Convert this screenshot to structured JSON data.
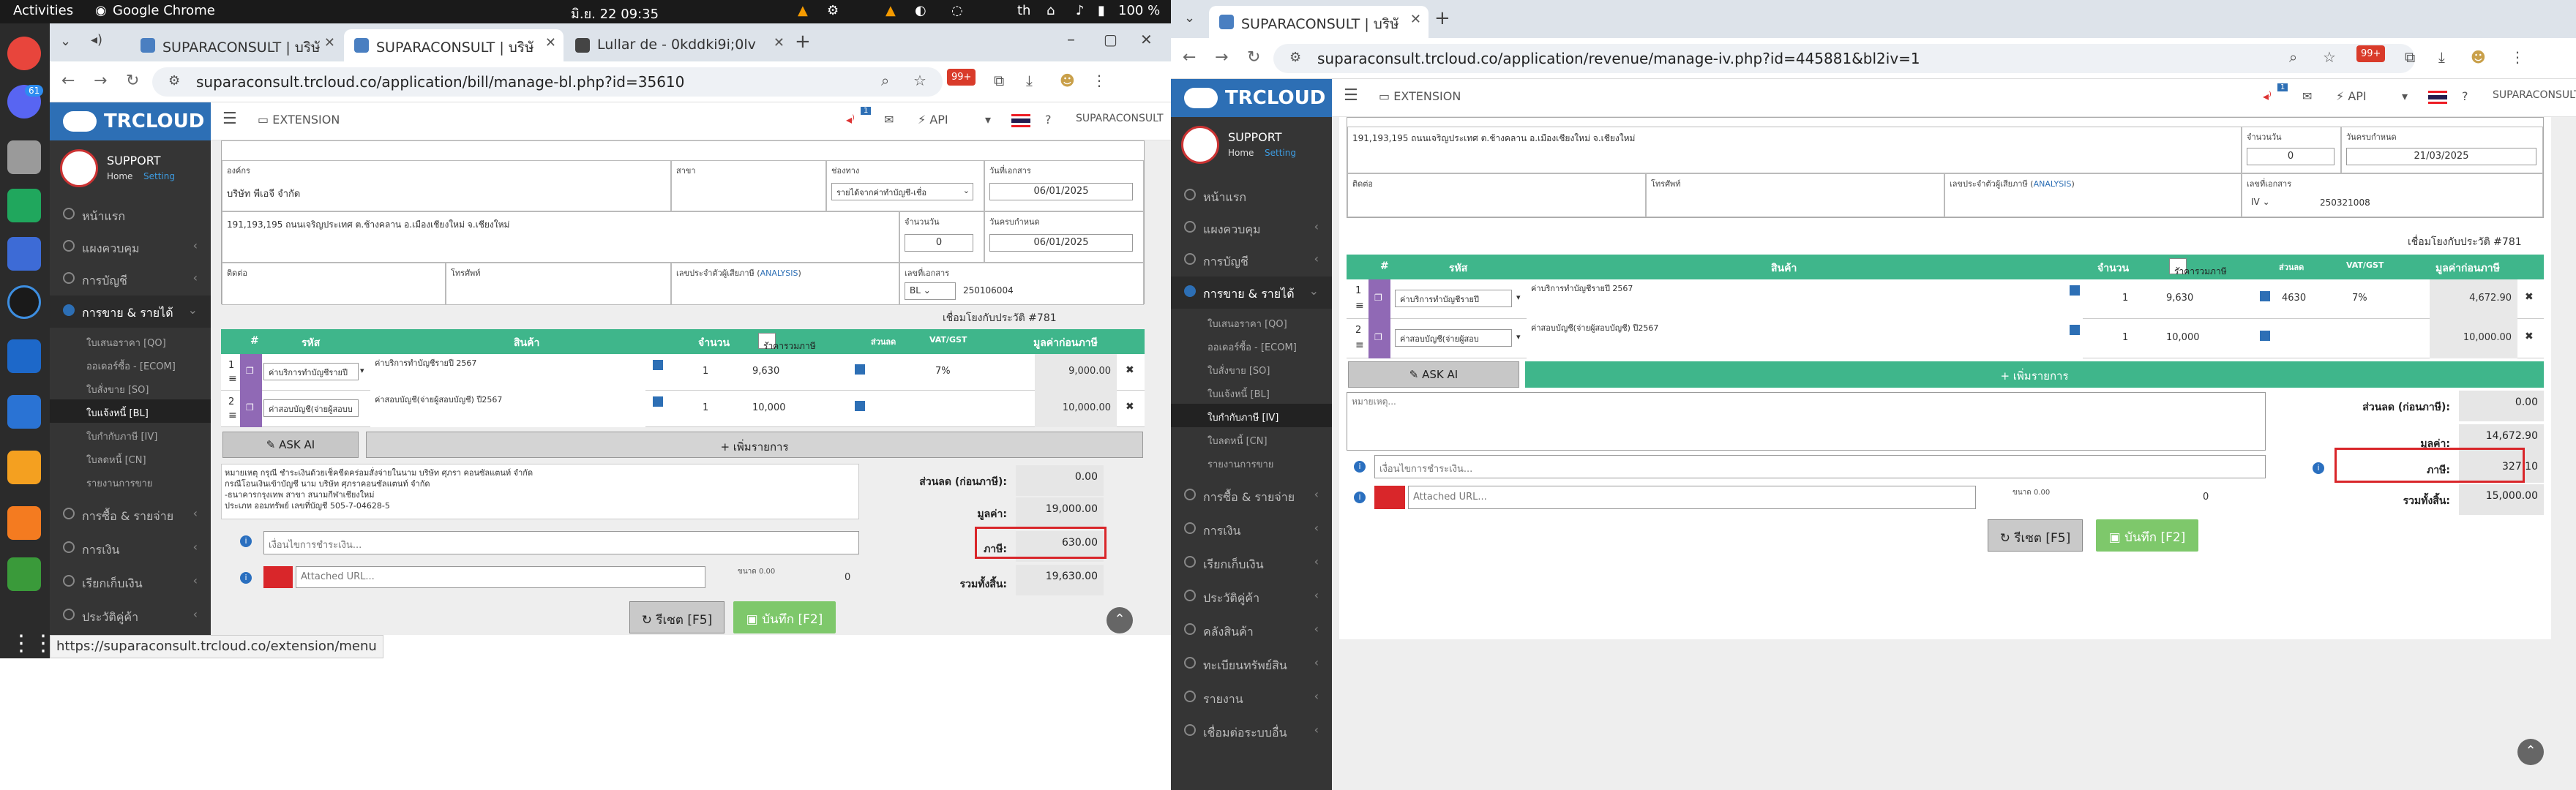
{
  "gnome": {
    "activities": "Activities",
    "app_name": "Google Chrome",
    "clock": "มิ.ย. 22  09:35",
    "lang": "th",
    "battery": "100 %"
  },
  "dock": {
    "discord_badge": "61"
  },
  "left_window": {
    "tabs": [
      {
        "label": "SUPARACONSULT | บริษั"
      },
      {
        "label": "SUPARACONSULT | บริษั"
      },
      {
        "label": "Lullar de - 0kddki9i;0lv"
      }
    ],
    "url": "suparaconsult.trcloud.co/application/bill/manage-bl.php?id=35610",
    "ext_badge": "99+",
    "brand": "TRCLOUD",
    "extension_label": "EXTENSION",
    "api_label": "API",
    "company_label": "SUPARACONSULT",
    "notif_count": "1",
    "user": {
      "name": "SUPPORT",
      "home": "Home",
      "setting": "Setting"
    },
    "menu": [
      {
        "label": "หน้าแรก"
      },
      {
        "label": "แผงควบคุม"
      },
      {
        "label": "การบัญชี"
      },
      {
        "label": "การขาย & รายได้"
      }
    ],
    "submenu": [
      {
        "label": "ใบเสนอราคา [QO]"
      },
      {
        "label": "ออเดอร์ซื้อ - [ECOM]"
      },
      {
        "label": "ใบสั่งขาย [SO]"
      },
      {
        "label": "ใบแจ้งหนี้ [BL]"
      },
      {
        "label": "ใบกำกับภาษี [IV]"
      },
      {
        "label": "ใบลดหนี้ [CN]"
      },
      {
        "label": "รายงานการขาย"
      }
    ],
    "menu_bottom": [
      {
        "label": "การซื้อ & รายจ่าย"
      },
      {
        "label": "การเงิน"
      },
      {
        "label": "เรียกเก็บเงิน"
      },
      {
        "label": "ประวัติคู่ค้า"
      }
    ],
    "form": {
      "customer_label": "องค์กร",
      "customer": "บริษัท พีเอจี จำกัด",
      "branch_label": "สาขา",
      "channel_label": "ช่องทาง",
      "channel": "รายได้จากค่าทำบัญชี-เชื่อ",
      "doc_date_label": "วันที่เอกสาร",
      "doc_date": "06/01/2025",
      "address": "191,193,195 ถนนเจริญประเทศ ต.ช้างคลาน อ.เมืองเชียงใหม่ จ.เชียงใหม่",
      "credit_label": "จำนวนวัน",
      "credit": "0",
      "due_label": "วันครบกำหนด",
      "due": "06/01/2025",
      "contact_label": "ติดต่อ",
      "phone_label": "โทรศัพท์",
      "tax_label": "เลขประจำตัวผู้เสียภาษี",
      "analysis": "ANALYSIS",
      "doc_no_label": "เลขที่เอกสาร",
      "doc_prefix": "BL",
      "doc_no": "250106004",
      "link_label": "เชื่อมโยงกับประวัติ #781"
    },
    "table": {
      "headers": [
        "#",
        "รหัส",
        "สินค้า",
        "จำนวน",
        "ราคารวมภาษี",
        "ส่วนลด",
        "VAT/GST",
        "มูลค่าก่อนภาษี"
      ],
      "rows": [
        {
          "num": "1",
          "code": "ค่าบริการทำบัญชีรายปี",
          "desc": "ค่าบริการทำบัญชีรายปี 2567",
          "qty": "1",
          "price": "9,630",
          "vat": "7%",
          "amount": "9,000.00"
        },
        {
          "num": "2",
          "code": "ค่าสอบบัญชี(จ่ายผู้สอบบ",
          "desc": "ค่าสอบบัญชี(จ่ายผู้สอบบัญชี) ปี2567",
          "qty": "1",
          "price": "10,000",
          "vat": "",
          "amount": "10,000.00"
        }
      ],
      "ask_ai": "ASK AI",
      "add_row": "+ เพิ่มรายการ"
    },
    "remark": "หมายเหตุ กรุณี ชำระเงินด้วยเช็คขีดคร่อมสั่งจ่ายในนาม บริษัท ศุภรา คอนซัลแตนท์ จำกัด\nกรณีโอนเงินเข้าบัญชี นาม บริษัท ศุภราคอนซัลแตนท์ จำกัด\n-ธนาคารกรุงเทพ สาขา สนามกีฬาเชียงใหม่\n ประเภท ออมทรัพย์ เลขที่บัญชี 505-7-04628-5",
    "payment_placeholder": "เงื่อนไขการชำระเงิน...",
    "attached_placeholder": "Attached URL...",
    "files_note": "ขนาด 0.00",
    "attach_count": "0",
    "summary": {
      "discount_label": "ส่วนลด (ก่อนภาษี):",
      "discount": "0.00",
      "value_label": "มูลค่า:",
      "value": "19,000.00",
      "tax_label": "ภาษี:",
      "tax": "630.00",
      "total_label": "รวมทั้งสิ้น:",
      "total": "19,630.00"
    },
    "reset_label": "รีเซต [F5]",
    "save_label": "บันทึก [F2]",
    "status_url": "https://suparaconsult.trcloud.co/extension/menu"
  },
  "right_window": {
    "tab": "SUPARACONSULT | บริษั",
    "url": "suparaconsult.trcloud.co/application/revenue/manage-iv.php?id=445881&bl2iv=1",
    "ext_badge": "99+",
    "brand": "TRCLOUD",
    "extension_label": "EXTENSION",
    "api_label": "API",
    "company_label": "SUPARACONSULT",
    "notif_count": "1",
    "user": {
      "name": "SUPPORT",
      "home": "Home",
      "setting": "Setting"
    },
    "menu": [
      {
        "label": "หน้าแรก"
      },
      {
        "label": "แผงควบคุม"
      },
      {
        "label": "การบัญชี"
      },
      {
        "label": "การขาย & รายได้"
      }
    ],
    "submenu": [
      {
        "label": "ใบเสนอราคา [QO]"
      },
      {
        "label": "ออเดอร์ซื้อ - [ECOM]"
      },
      {
        "label": "ใบสั่งขาย [SO]"
      },
      {
        "label": "ใบแจ้งหนี้ [BL]"
      },
      {
        "label": "ใบกำกับภาษี [IV]"
      },
      {
        "label": "ใบลดหนี้ [CN]"
      },
      {
        "label": "รายงานการขาย"
      }
    ],
    "menu_bottom": [
      {
        "label": "การซื้อ & รายจ่าย"
      },
      {
        "label": "การเงิน"
      },
      {
        "label": "เรียกเก็บเงิน"
      },
      {
        "label": "ประวัติคู่ค้า"
      },
      {
        "label": "คลังสินค้า"
      },
      {
        "label": "ทะเบียนทรัพย์สิน"
      },
      {
        "label": "รายงาน"
      },
      {
        "label": "เชื่อมต่อระบบอื่น"
      }
    ],
    "form": {
      "address": "191,193,195 ถนนเจริญประเทศ ต.ช้างคลาน อ.เมืองเชียงใหม่ จ.เชียงใหม่",
      "credit_label": "จำนวนวัน",
      "credit": "0",
      "due_label": "วันครบกำหนด",
      "due": "21/03/2025",
      "contact_label": "ติดต่อ",
      "phone_label": "โทรศัพท์",
      "tax_label": "เลขประจำตัวผู้เสียภาษี",
      "analysis": "ANALYSIS",
      "doc_no_label": "เลขที่เอกสาร",
      "doc_prefix": "IV",
      "doc_no": "250321008",
      "link_label": "เชื่อมโยงกับประวัติ #781"
    },
    "table": {
      "headers": [
        "#",
        "รหัส",
        "สินค้า",
        "จำนวน",
        "ราคารวมภาษี",
        "ส่วนลด",
        "VAT/GST",
        "มูลค่าก่อนภาษี"
      ],
      "rows": [
        {
          "num": "1",
          "code": "ค่าบริการทำบัญชีรายปี",
          "desc": "ค่าบริการทำบัญชีรายปี 2567",
          "qty": "1",
          "price": "9,630",
          "disc": "4630",
          "vat": "7%",
          "amount": "4,672.90"
        },
        {
          "num": "2",
          "code": "ค่าสอบบัญชี(จ่ายผู้สอบ",
          "desc": "ค่าสอบบัญชี(จ่ายผู้สอบบัญชี) ปี2567",
          "qty": "1",
          "price": "10,000",
          "disc": "",
          "vat": "",
          "amount": "10,000.00"
        }
      ],
      "ask_ai": "ASK AI",
      "add_row": "+ เพิ่มรายการ"
    },
    "remark_placeholder": "หมายเหตุ...",
    "payment_placeholder": "เงื่อนไขการชำระเงิน...",
    "attached_placeholder": "Attached URL...",
    "files_note": "ขนาด 0.00",
    "attach_count": "0",
    "summary": {
      "discount_label": "ส่วนลด (ก่อนภาษี):",
      "discount": "0.00",
      "value_label": "มูลค่า:",
      "value": "14,672.90",
      "tax_label": "ภาษี:",
      "tax": "327.10",
      "total_label": "รวมทั้งสิ้น:",
      "total": "15,000.00"
    },
    "reset_label": "รีเซต [F5]",
    "save_label": "บันทึก [F2]"
  },
  "colors": {
    "green": "#3fb68b",
    "purple": "#9069b5",
    "save_green": "#7ec86b",
    "highlight_red": "#d9262a",
    "sidebar": "#353535",
    "brand_blue": "#2d6fb5"
  }
}
